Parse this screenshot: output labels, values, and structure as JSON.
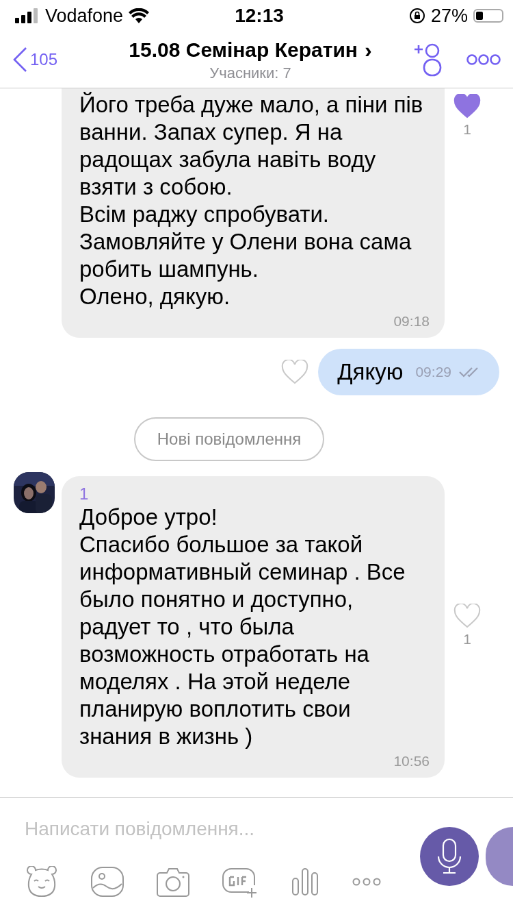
{
  "status_bar": {
    "carrier": "Vodafone",
    "time": "12:13",
    "battery": "27%"
  },
  "header": {
    "back_count": "105",
    "title": "15.08 Семінар Кератин",
    "chevron": "›",
    "subtitle": "Учасники: 7"
  },
  "messages": [
    {
      "kind": "incoming",
      "cut_top": true,
      "text": "Його треба дуже мало, а піни пів ванни. Запах супер. Я на радощах забула навіть воду взяти з собою.\nВсім раджу спробувати.\nЗамовляйте у Олени вона сама робить шампунь.\nОлено, дякую.",
      "time": "09:18",
      "liked": true,
      "like_count": "1"
    },
    {
      "kind": "outgoing",
      "text": "Дякую",
      "time": "09:29",
      "liked": false
    },
    {
      "kind": "divider",
      "text": "Нові повідомлення"
    },
    {
      "kind": "incoming",
      "cut_top": false,
      "avatar": true,
      "sender": "1",
      "text": "Доброе утро!\nСпасибо большое за такой информативный семинар . Все было понятно и доступно, радует то , что была возможность отработать на моделях . На этой неделе планирую воплотить свои знания в жизнь )",
      "time": "10:56",
      "liked": false,
      "like_count": "1"
    }
  ],
  "composer": {
    "placeholder": "Написати повідомлення..."
  }
}
